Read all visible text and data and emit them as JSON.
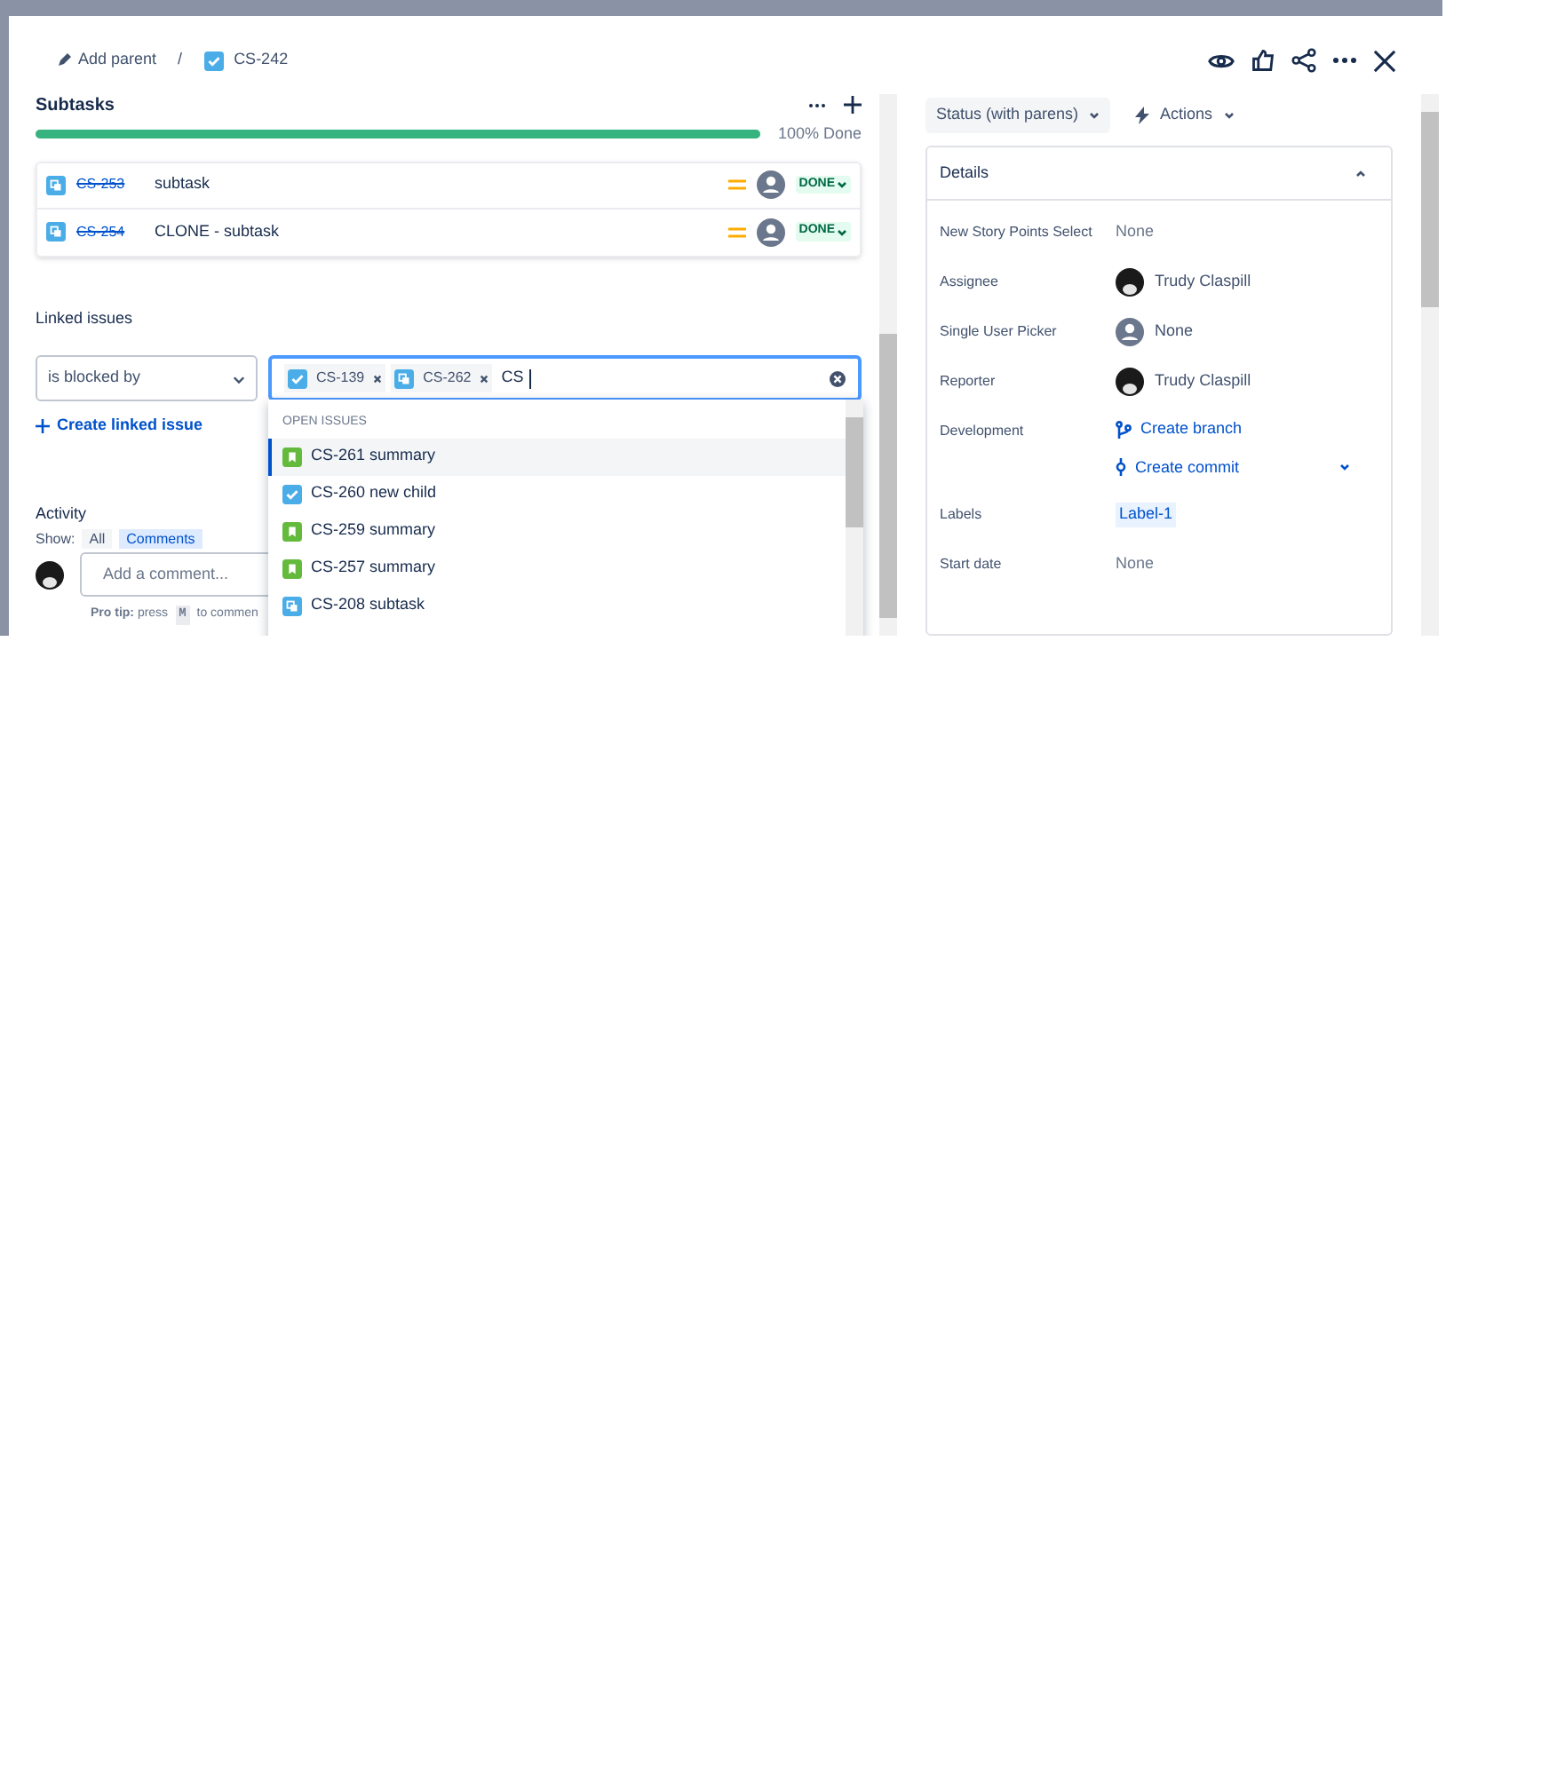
{
  "breadcrumbs": [
    {
      "kind": "action",
      "label": "Add parent"
    },
    {
      "kind": "separator",
      "label": "/"
    },
    {
      "kind": "issue",
      "label": "CS-242"
    }
  ],
  "subtasks": {
    "title": "Subtasks",
    "level": 1,
    "progress_label": "100% Done",
    "items": [
      {
        "key": "CS-253",
        "summary": "subtask",
        "done": true,
        "status": "DONE"
      },
      {
        "key": "CS-254",
        "summary": "CLONE - subtask",
        "done": true,
        "status": "DONE"
      }
    ]
  },
  "linked_issues": {
    "title": "Linked issues",
    "relation": "is blocked by",
    "tags": [
      {
        "key": "CS-139",
        "kind": "task"
      },
      {
        "key": "CS-262",
        "kind": "subtask"
      }
    ],
    "value": "CS",
    "create_label": "Create linked issue"
  },
  "dropdown": {
    "section": "OPEN ISSUES",
    "items": [
      {
        "label": "CS-261 summary",
        "kind": "story",
        "selected": true
      },
      {
        "label": "CS-260 new child",
        "kind": "task",
        "selected": false
      },
      {
        "label": "CS-259 summary",
        "kind": "story",
        "selected": false
      },
      {
        "label": "CS-257 summary",
        "kind": "story",
        "selected": false
      },
      {
        "label": "CS-208 subtask",
        "kind": "subtask",
        "selected": false
      }
    ]
  },
  "activity": {
    "title": "Activity",
    "show_label": "Show:",
    "filters": [
      {
        "label": "All",
        "selected": false
      },
      {
        "label": "Comments",
        "selected": true
      }
    ],
    "comment_placeholder": "Add a comment...",
    "pro_tip": "**Pro tip:** press",
    "pro_tip_key": "M",
    "pro_tip_rest": "to commen"
  },
  "status_button": "Status (with parens)",
  "actions_button": "Actions",
  "details": {
    "title": "Details",
    "expanded": true,
    "fields": [
      {
        "label": "New Story Points Select",
        "kind": "text",
        "value": "None"
      },
      {
        "label": "Assignee",
        "kind": "user",
        "value": "Trudy Claspill"
      },
      {
        "label": "Single User Picker",
        "kind": "empty_user",
        "value": "None"
      },
      {
        "label": "Reporter",
        "kind": "user",
        "value": "Trudy Claspill"
      },
      {
        "label": "Development",
        "kind": "dev",
        "links": [
          "Create branch",
          "Create commit"
        ]
      },
      {
        "label": "Labels",
        "kind": "labels",
        "labels": [
          "Label-1"
        ]
      },
      {
        "label": "Start date",
        "kind": "text",
        "value": "None"
      }
    ]
  }
}
